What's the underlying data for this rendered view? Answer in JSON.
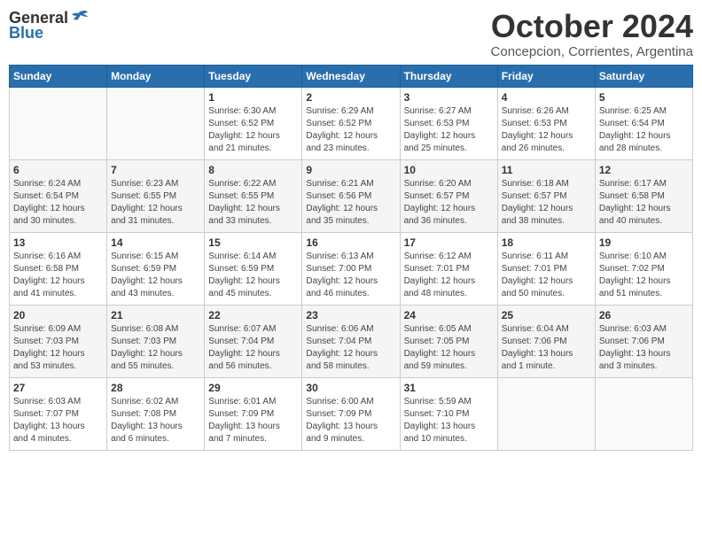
{
  "logo": {
    "general": "General",
    "blue": "Blue",
    "tagline": "General Blue"
  },
  "title": "October 2024",
  "subtitle": "Concepcion, Corrientes, Argentina",
  "days_of_week": [
    "Sunday",
    "Monday",
    "Tuesday",
    "Wednesday",
    "Thursday",
    "Friday",
    "Saturday"
  ],
  "weeks": [
    [
      {
        "day": "",
        "content": ""
      },
      {
        "day": "",
        "content": ""
      },
      {
        "day": "1",
        "content": "Sunrise: 6:30 AM\nSunset: 6:52 PM\nDaylight: 12 hours\nand 21 minutes."
      },
      {
        "day": "2",
        "content": "Sunrise: 6:29 AM\nSunset: 6:52 PM\nDaylight: 12 hours\nand 23 minutes."
      },
      {
        "day": "3",
        "content": "Sunrise: 6:27 AM\nSunset: 6:53 PM\nDaylight: 12 hours\nand 25 minutes."
      },
      {
        "day": "4",
        "content": "Sunrise: 6:26 AM\nSunset: 6:53 PM\nDaylight: 12 hours\nand 26 minutes."
      },
      {
        "day": "5",
        "content": "Sunrise: 6:25 AM\nSunset: 6:54 PM\nDaylight: 12 hours\nand 28 minutes."
      }
    ],
    [
      {
        "day": "6",
        "content": "Sunrise: 6:24 AM\nSunset: 6:54 PM\nDaylight: 12 hours\nand 30 minutes."
      },
      {
        "day": "7",
        "content": "Sunrise: 6:23 AM\nSunset: 6:55 PM\nDaylight: 12 hours\nand 31 minutes."
      },
      {
        "day": "8",
        "content": "Sunrise: 6:22 AM\nSunset: 6:55 PM\nDaylight: 12 hours\nand 33 minutes."
      },
      {
        "day": "9",
        "content": "Sunrise: 6:21 AM\nSunset: 6:56 PM\nDaylight: 12 hours\nand 35 minutes."
      },
      {
        "day": "10",
        "content": "Sunrise: 6:20 AM\nSunset: 6:57 PM\nDaylight: 12 hours\nand 36 minutes."
      },
      {
        "day": "11",
        "content": "Sunrise: 6:18 AM\nSunset: 6:57 PM\nDaylight: 12 hours\nand 38 minutes."
      },
      {
        "day": "12",
        "content": "Sunrise: 6:17 AM\nSunset: 6:58 PM\nDaylight: 12 hours\nand 40 minutes."
      }
    ],
    [
      {
        "day": "13",
        "content": "Sunrise: 6:16 AM\nSunset: 6:58 PM\nDaylight: 12 hours\nand 41 minutes."
      },
      {
        "day": "14",
        "content": "Sunrise: 6:15 AM\nSunset: 6:59 PM\nDaylight: 12 hours\nand 43 minutes."
      },
      {
        "day": "15",
        "content": "Sunrise: 6:14 AM\nSunset: 6:59 PM\nDaylight: 12 hours\nand 45 minutes."
      },
      {
        "day": "16",
        "content": "Sunrise: 6:13 AM\nSunset: 7:00 PM\nDaylight: 12 hours\nand 46 minutes."
      },
      {
        "day": "17",
        "content": "Sunrise: 6:12 AM\nSunset: 7:01 PM\nDaylight: 12 hours\nand 48 minutes."
      },
      {
        "day": "18",
        "content": "Sunrise: 6:11 AM\nSunset: 7:01 PM\nDaylight: 12 hours\nand 50 minutes."
      },
      {
        "day": "19",
        "content": "Sunrise: 6:10 AM\nSunset: 7:02 PM\nDaylight: 12 hours\nand 51 minutes."
      }
    ],
    [
      {
        "day": "20",
        "content": "Sunrise: 6:09 AM\nSunset: 7:03 PM\nDaylight: 12 hours\nand 53 minutes."
      },
      {
        "day": "21",
        "content": "Sunrise: 6:08 AM\nSunset: 7:03 PM\nDaylight: 12 hours\nand 55 minutes."
      },
      {
        "day": "22",
        "content": "Sunrise: 6:07 AM\nSunset: 7:04 PM\nDaylight: 12 hours\nand 56 minutes."
      },
      {
        "day": "23",
        "content": "Sunrise: 6:06 AM\nSunset: 7:04 PM\nDaylight: 12 hours\nand 58 minutes."
      },
      {
        "day": "24",
        "content": "Sunrise: 6:05 AM\nSunset: 7:05 PM\nDaylight: 12 hours\nand 59 minutes."
      },
      {
        "day": "25",
        "content": "Sunrise: 6:04 AM\nSunset: 7:06 PM\nDaylight: 13 hours\nand 1 minute."
      },
      {
        "day": "26",
        "content": "Sunrise: 6:03 AM\nSunset: 7:06 PM\nDaylight: 13 hours\nand 3 minutes."
      }
    ],
    [
      {
        "day": "27",
        "content": "Sunrise: 6:03 AM\nSunset: 7:07 PM\nDaylight: 13 hours\nand 4 minutes."
      },
      {
        "day": "28",
        "content": "Sunrise: 6:02 AM\nSunset: 7:08 PM\nDaylight: 13 hours\nand 6 minutes."
      },
      {
        "day": "29",
        "content": "Sunrise: 6:01 AM\nSunset: 7:09 PM\nDaylight: 13 hours\nand 7 minutes."
      },
      {
        "day": "30",
        "content": "Sunrise: 6:00 AM\nSunset: 7:09 PM\nDaylight: 13 hours\nand 9 minutes."
      },
      {
        "day": "31",
        "content": "Sunrise: 5:59 AM\nSunset: 7:10 PM\nDaylight: 13 hours\nand 10 minutes."
      },
      {
        "day": "",
        "content": ""
      },
      {
        "day": "",
        "content": ""
      }
    ]
  ]
}
